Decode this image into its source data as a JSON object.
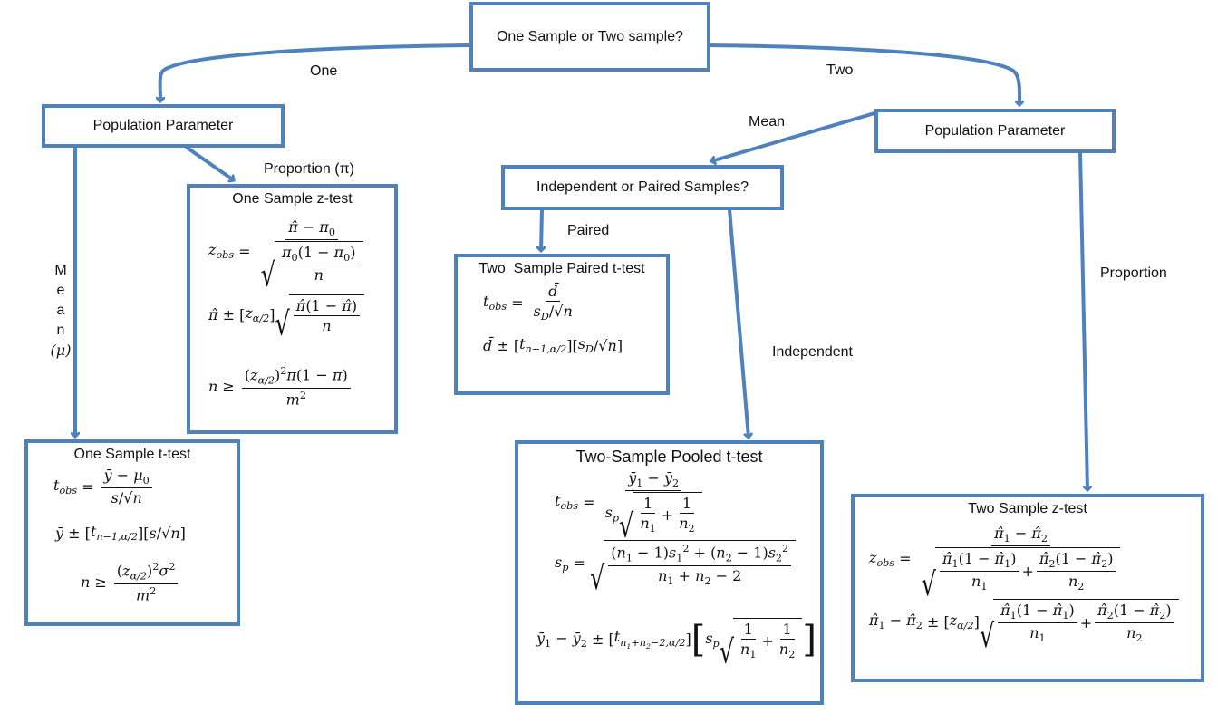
{
  "diagram": {
    "root": "One Sample or Two sample?",
    "branch_one": "One",
    "branch_two": "Two",
    "left_param": "Population Parameter",
    "right_param": "Population Parameter",
    "edge_proportion_pi": "Proportion (π)",
    "edge_mean_mu_letters": [
      "M",
      "e",
      "a",
      "n",
      "(μ)"
    ],
    "edge_mean": "Mean",
    "edge_proportion": "Proportion",
    "indep_paired": "Independent or Paired Samples?",
    "edge_paired": "Paired",
    "edge_independent": "Independent",
    "boxes": {
      "one_z": {
        "title": "One Sample z-test",
        "test_stat": "z_obs = (π̂ − π₀) / √(π₀(1 − π₀)/n)",
        "ci": "π̂ ± [z_{α/2}] √(π̂(1 − π̂)/n)",
        "sample_size": "n ≥ (z_{α/2})² π(1 − π) / m²"
      },
      "one_t": {
        "title": "One Sample t-test",
        "test_stat": "t_obs = (ȳ − μ₀) / (s/√n)",
        "ci": "ȳ ± [t_{n−1,α/2}][s/√n]",
        "sample_size": "n ≥ (z_{α/2})² σ² / m²"
      },
      "paired_t": {
        "title": "Two  Sample Paired t-test",
        "test_stat": "t_obs = d̄ / (s_D/√n)",
        "ci": "d̄ ± [t_{n−1,α/2}][s_D/√n]"
      },
      "pooled_t": {
        "title": "Two-Sample Pooled t-test",
        "test_stat": "t_obs = (ȳ₁ − ȳ₂) / (s_p √(1/n₁ + 1/n₂))",
        "pooled_sd": "s_p = √(((n₁ − 1)s₁² + (n₂ − 1)s₂²)/(n₁ + n₂ − 2))",
        "ci": "ȳ₁ − ȳ₂ ± [t_{n₁+n₂−2,α/2}][s_p √(1/n₁ + 1/n₂)]"
      },
      "two_z": {
        "title": "Two Sample z-test",
        "test_stat": "z_obs = (π̂₁ − π̂₂) / √(π̂₁(1 − π̂₁)/n₁ + π̂₂(1 − π̂₂)/n₂)",
        "ci": "π̂₁ − π̂₂ ± [z_{α/2}] √(π̂₁(1 − π̂₁)/n₁ + π̂₂(1 − π̂₂)/n₂)"
      }
    }
  },
  "colors": {
    "stroke": "#4f81bd"
  }
}
